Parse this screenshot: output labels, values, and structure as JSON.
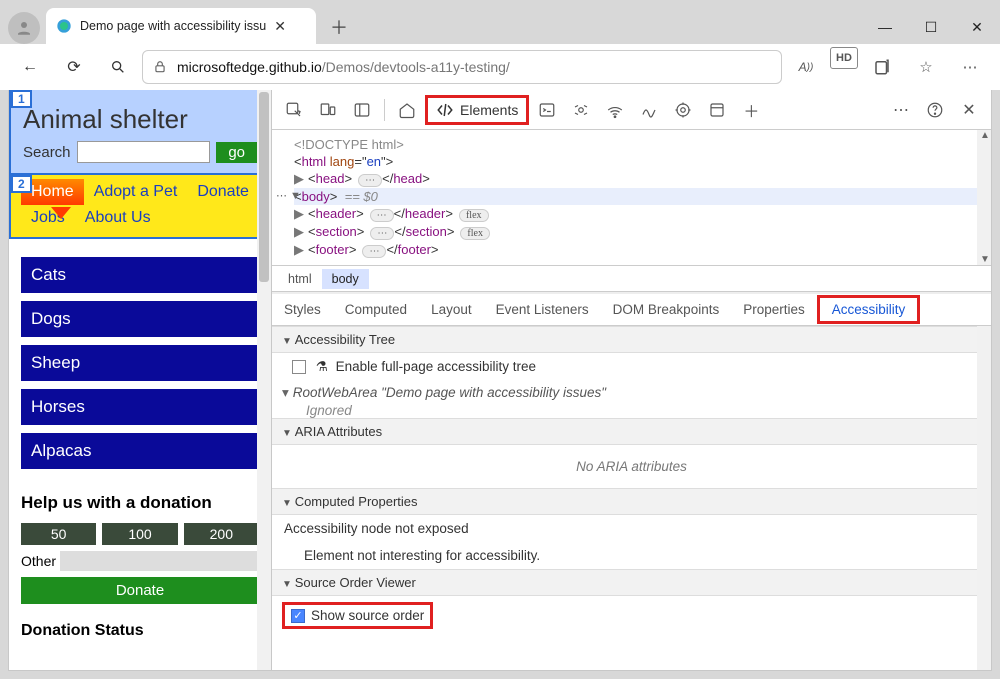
{
  "browser": {
    "tab_title": "Demo page with accessibility issu",
    "url_domain": "microsoftedge.github.io",
    "url_path": "/Demos/devtools-a11y-testing/",
    "toolbar_right": {
      "readaloud": "A))",
      "hd": "HD"
    }
  },
  "page": {
    "order_header": "1",
    "order_nav": "2",
    "title": "Animal shelter",
    "search_label": "Search",
    "go": "go",
    "nav": [
      "Home",
      "Adopt a Pet",
      "Donate",
      "Jobs",
      "About Us"
    ],
    "categories": [
      "Cats",
      "Dogs",
      "Sheep",
      "Horses",
      "Alpacas"
    ],
    "donate_heading": "Help us with a donation",
    "donate_amounts": [
      "50",
      "100",
      "200"
    ],
    "donate_other_label": "Other",
    "donate_button": "Donate",
    "status_heading": "Donation Status"
  },
  "devtools": {
    "elements_tab": "Elements",
    "dom": {
      "doctype": "<!DOCTYPE html>",
      "html_open": "html",
      "html_lang": "en",
      "head": "head",
      "body": "body",
      "body_eq": "== $0",
      "header": "header",
      "section": "section",
      "footer": "footer",
      "flex_badge": "flex",
      "ellipsis": "⋯"
    },
    "crumbs": [
      "html",
      "body"
    ],
    "side_tabs": [
      "Styles",
      "Computed",
      "Layout",
      "Event Listeners",
      "DOM Breakpoints",
      "Properties",
      "Accessibility"
    ],
    "a11y": {
      "tree_head": "Accessibility Tree",
      "fullpage_label": "Enable full-page accessibility tree",
      "root_label": "RootWebArea \"Demo page with accessibility issues\"",
      "ignored": "Ignored",
      "aria_head": "ARIA Attributes",
      "no_aria": "No ARIA attributes",
      "computed_head": "Computed Properties",
      "not_exposed": "Accessibility node not exposed",
      "not_interesting": "Element not interesting for accessibility.",
      "sov_head": "Source Order Viewer",
      "sov_label": "Show source order"
    }
  }
}
